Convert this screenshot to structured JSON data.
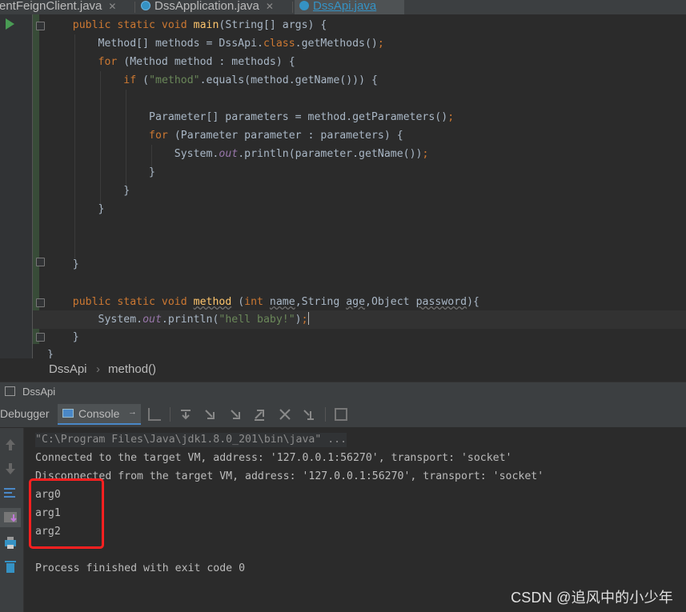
{
  "tabs": [
    {
      "label": "rentFeignClient.java",
      "active": false
    },
    {
      "label": "DssApplication.java",
      "active": false
    },
    {
      "label": "DssApi.java",
      "active": true
    }
  ],
  "code": {
    "l1": {
      "a": "    ",
      "k1": "public static void ",
      "fn": "main",
      "b": "(String[] args) {"
    },
    "l2": {
      "a": "        Method[] methods = DssApi.",
      "k1": "class",
      "b": ".getMethods()",
      "semi": ";"
    },
    "l3": {
      "a": "        ",
      "k1": "for ",
      "b": "(Method method : methods) {"
    },
    "l4": {
      "a": "            ",
      "k1": "if ",
      "b": "(",
      "s": "\"method\"",
      "c": ".equals(method.getName())) {"
    },
    "l5": {
      "a": "                Parameter[] parameters = method.getParameters()",
      "semi": ";"
    },
    "l6": {
      "a": "                ",
      "k1": "for ",
      "b": "(Parameter parameter : parameters) {"
    },
    "l7": {
      "a": "                    System.",
      "it": "out",
      "b": ".println(parameter.getName())",
      "semi": ";"
    },
    "l8": "                }",
    "l9": "            }",
    "l10": "        }",
    "l11": "    }",
    "l12": {
      "a": "    ",
      "k1": "public static void ",
      "m": "method",
      "b": " (",
      "k2": "int ",
      "p1": "name",
      "c": ",String ",
      "p2": "age",
      "d": ",Object ",
      "p3": "password",
      "e": "){"
    },
    "l13": {
      "a": "        System.",
      "it": "out",
      "b": ".println(",
      "s": "\"hell baby!\"",
      "c": ")",
      "semi": ";"
    },
    "l14": "    }",
    "l15": "}"
  },
  "breadcrumb": {
    "class": "DssApi",
    "method": "method()",
    "separator": "›"
  },
  "run": {
    "title": "DssApi",
    "debugger_tab": "Debugger",
    "console_tab": "Console",
    "console_arrow": "→"
  },
  "console": {
    "cmd": "\"C:\\Program Files\\Java\\jdk1.8.0_201\\bin\\java\" ...",
    "connected": "Connected to the target VM, address: '127.0.0.1:56270', transport: 'socket'",
    "disconnected": "Disconnected from the target VM, address: '127.0.0.1:56270', transport: 'socket'",
    "out": [
      "arg0",
      "arg1",
      "arg2"
    ],
    "exit": "Process finished with exit code 0"
  },
  "watermark": "CSDN @追风中的小少年",
  "colors": {
    "keyword": "#cc7832",
    "function": "#ffc66d",
    "string": "#6a8759",
    "static_field": "#9876aa",
    "highlight_box": "#ff2020",
    "active_tab": "#3592c4"
  }
}
